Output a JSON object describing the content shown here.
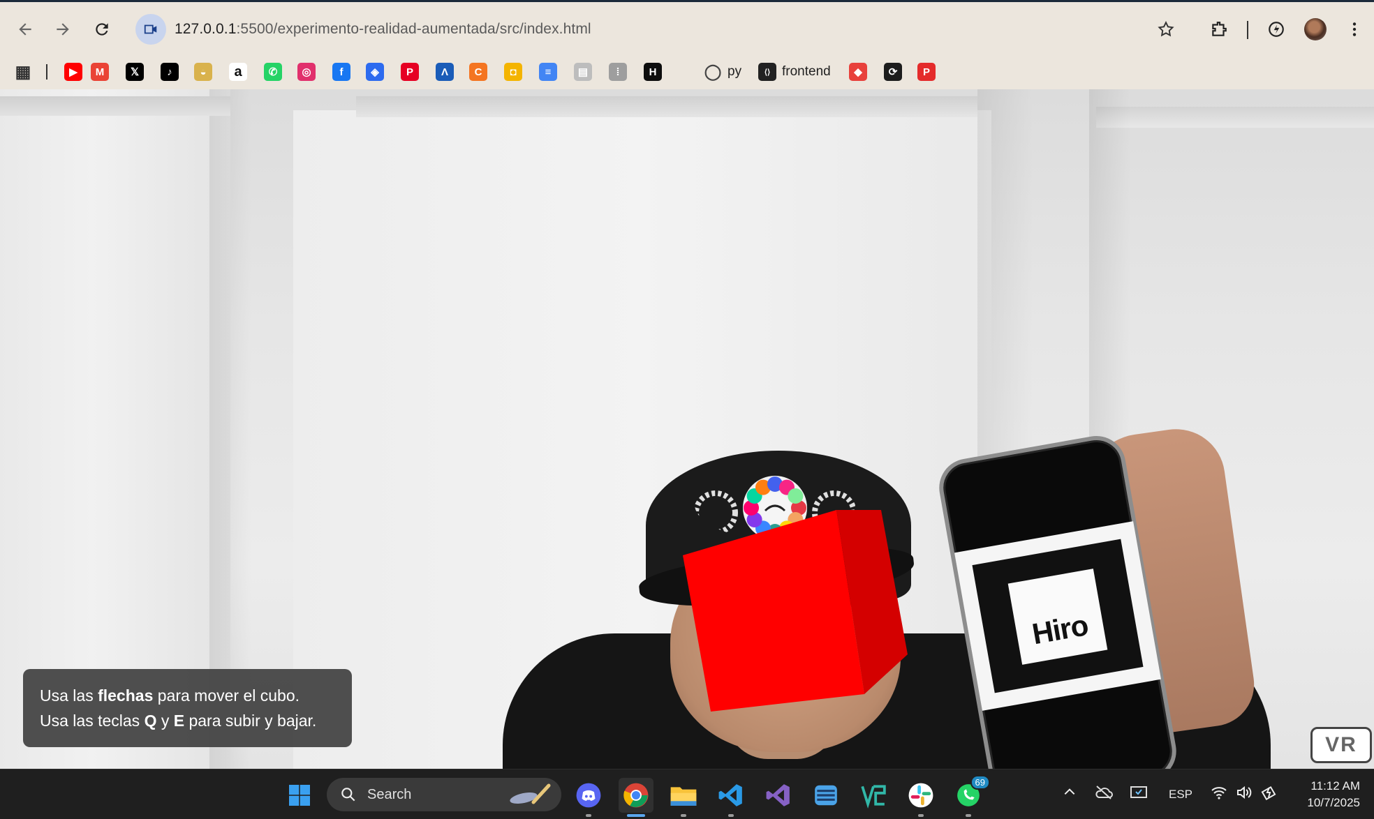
{
  "browser": {
    "url_host": "127.0.0.1",
    "url_path": ":5500/experimento-realidad-aumentada/src/index.html",
    "bookmarks": [
      {
        "icon": "apps-grid-icon",
        "label": ""
      },
      {
        "icon": "youtube-icon",
        "label": "",
        "color": "#ff0000"
      },
      {
        "icon": "gmail-icon",
        "label": "",
        "color": "#ea4335"
      },
      {
        "icon": "x-icon",
        "label": "",
        "color": "#000000"
      },
      {
        "icon": "tiktok-icon",
        "label": "",
        "color": "#000000"
      },
      {
        "icon": "food-icon",
        "label": "",
        "color": "#d9b24c"
      },
      {
        "icon": "amazon-icon",
        "label": "",
        "color": "#ffffff"
      },
      {
        "icon": "whatsapp-icon",
        "label": "",
        "color": "#25d366"
      },
      {
        "icon": "instagram-icon",
        "label": "",
        "color": "#e1306c"
      },
      {
        "icon": "facebook-icon",
        "label": "",
        "color": "#1877f2"
      },
      {
        "icon": "blue-app-icon",
        "label": "",
        "color": "#2d6bef"
      },
      {
        "icon": "pinterest-icon",
        "label": "",
        "color": "#e60023"
      },
      {
        "icon": "arc-icon",
        "label": "",
        "color": "#1a5cb8"
      },
      {
        "icon": "crunchyroll-icon",
        "label": "",
        "color": "#f47521"
      },
      {
        "icon": "classroom-icon",
        "label": "",
        "color": "#f4b400"
      },
      {
        "icon": "docs-icon",
        "label": "",
        "color": "#4285f4"
      },
      {
        "icon": "paper-icon",
        "label": "",
        "color": "#bdbdbd"
      },
      {
        "icon": "cisco-icon",
        "label": "",
        "color": "#9e9e9e"
      },
      {
        "icon": "hackerrank-icon",
        "label": "",
        "color": "#0d0d0d"
      },
      {
        "icon": "github-icon",
        "label": "py"
      },
      {
        "icon": "frontend-icon",
        "label": "frontend"
      },
      {
        "icon": "ruby-icon",
        "label": "",
        "color": "#e8413c"
      },
      {
        "icon": "dark-app-icon",
        "label": "",
        "color": "#1d1d1d"
      },
      {
        "icon": "p-icon",
        "label": "",
        "color": "#e42b2b"
      }
    ]
  },
  "overlay": {
    "line1_pre": "Usa las ",
    "line1_bold": "flechas",
    "line1_post": " para mover el cubo.",
    "line2_pre": "Usa las teclas ",
    "line2_bold1": "Q",
    "line2_mid": " y ",
    "line2_bold2": "E",
    "line2_post": " para subir y bajar.",
    "vr_label": "VR",
    "marker_text": "Hiro",
    "cube_color": "#ff0000"
  },
  "taskbar": {
    "search_label": "Search",
    "whatsapp_badge": "69",
    "language": "ESP",
    "time": "11:12 AM",
    "date": "10/7/2025"
  }
}
